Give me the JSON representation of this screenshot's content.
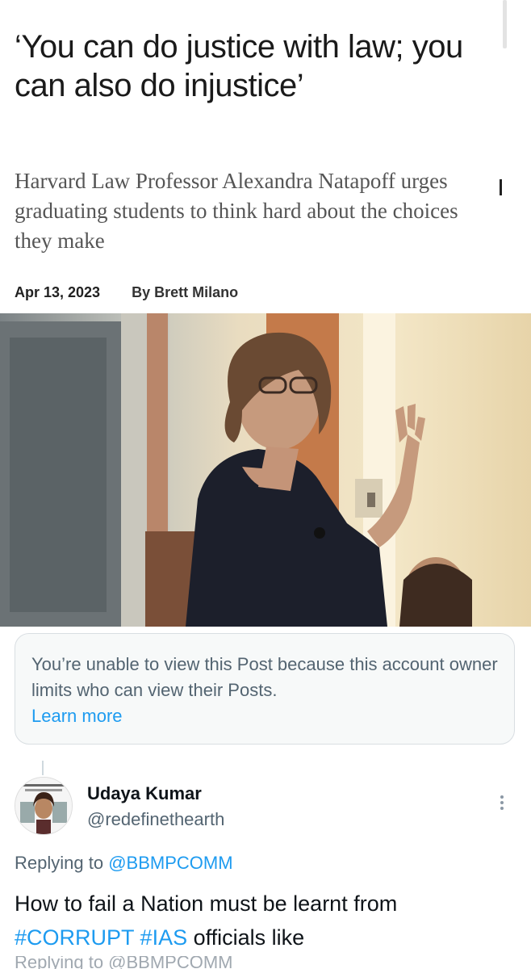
{
  "article": {
    "headline": "‘You can do justice with law; you can also do injustice’",
    "subhead": "Harvard Law Professor Alexandra Natapoff urges graduating students to think hard about the choices they make",
    "date": "Apr 13, 2023",
    "byline": "By Brett Milano"
  },
  "notice": {
    "text": "You’re unable to view this Post because this account owner limits who can view their Posts.",
    "link": "Learn more"
  },
  "post": {
    "name": "Udaya Kumar",
    "handle": "@redefinethearth",
    "replying_prefix": "Replying to",
    "replying_mention": "@BBMPCOMM",
    "text_start": "How to fail a Nation must be learnt from",
    "hashtag_1": "#CORRUPT",
    "hashtag_2": "#IAS",
    "text_end": "officials like",
    "cutoff_text": "Replying to @BBMPCOMM"
  },
  "colors": {
    "link": "#1d9bf0",
    "muted": "#536471",
    "text": "#0f1419"
  },
  "icons": {
    "more": "more-vertical-icon"
  }
}
